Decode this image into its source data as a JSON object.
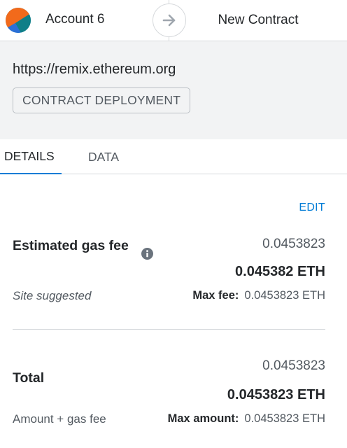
{
  "header": {
    "account_name": "Account 6",
    "recipient": "New Contract"
  },
  "origin": {
    "url": "https://remix.ethereum.org",
    "method": "CONTRACT DEPLOYMENT"
  },
  "tabs": [
    {
      "label": "DETAILS",
      "active": true
    },
    {
      "label": "DATA",
      "active": false
    }
  ],
  "details": {
    "edit_label": "EDIT",
    "gas": {
      "label": "Estimated gas fee",
      "fiat_value": "0.0453823",
      "eth_value": "0.045382 ETH",
      "sublabel": "Site suggested",
      "max_label": "Max fee:",
      "max_value": "0.0453823 ETH"
    },
    "total": {
      "label": "Total",
      "fiat_value": "0.0453823",
      "eth_value": "0.0453823 ETH",
      "sublabel": "Amount + gas fee",
      "max_label": "Max amount:",
      "max_value": "0.0453823 ETH"
    }
  },
  "colors": {
    "accent": "#037dd6",
    "text": "#24272a",
    "muted": "#535a61",
    "panel_bg": "#f2f3f4",
    "border": "#d6d9dc"
  },
  "icons": [
    "account-avatar-icon",
    "arrow-right-icon",
    "info-icon"
  ]
}
